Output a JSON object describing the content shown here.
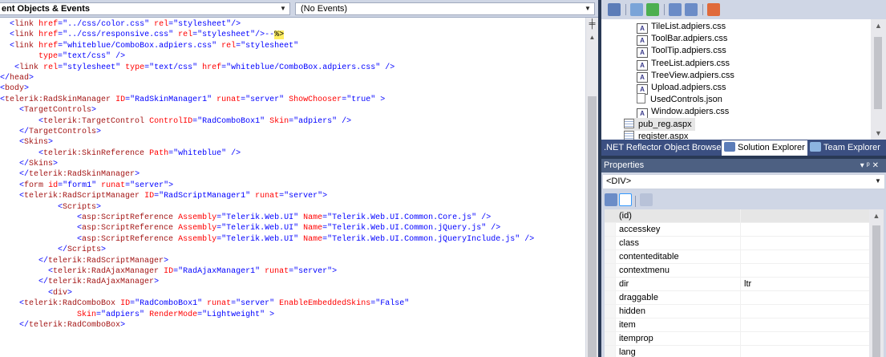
{
  "editor": {
    "nav_left": "ent Objects & Events",
    "nav_right": "(No Events)"
  },
  "code_lines": [
    [
      [
        "tx",
        "  "
      ],
      [
        "tb",
        "<"
      ],
      [
        "tk",
        "link"
      ],
      [
        "tx",
        " "
      ],
      [
        "tr",
        "href"
      ],
      [
        "tb",
        "=\"../css/color.css\""
      ],
      [
        "tx",
        " "
      ],
      [
        "tr",
        "rel"
      ],
      [
        "tb",
        "=\"stylesheet\"/>"
      ]
    ],
    [
      [
        "tx",
        "  "
      ],
      [
        "tb",
        "<"
      ],
      [
        "tk",
        "link"
      ],
      [
        "tx",
        " "
      ],
      [
        "tr",
        "href"
      ],
      [
        "tb",
        "=\"../css/responsive.css\""
      ],
      [
        "tx",
        " "
      ],
      [
        "tr",
        "rel"
      ],
      [
        "tb",
        "=\"stylesheet\"/>--"
      ],
      [
        "ty",
        "%>"
      ]
    ],
    [
      [
        "tx",
        "  "
      ],
      [
        "tb",
        "<"
      ],
      [
        "tk",
        "link"
      ],
      [
        "tx",
        " "
      ],
      [
        "tr",
        "href"
      ],
      [
        "tb",
        "=\"whiteblue/ComboBox.adpiers.css\""
      ],
      [
        "tx",
        " "
      ],
      [
        "tr",
        "rel"
      ],
      [
        "tb",
        "=\"stylesheet\""
      ]
    ],
    [
      [
        "tx",
        "        "
      ],
      [
        "tr",
        "type"
      ],
      [
        "tb",
        "=\"text/css\""
      ],
      [
        "tx",
        " "
      ],
      [
        "tb",
        "/>"
      ]
    ],
    [
      [
        "tx",
        "   "
      ],
      [
        "tb",
        "<"
      ],
      [
        "tk",
        "link"
      ],
      [
        "tx",
        " "
      ],
      [
        "tr",
        "rel"
      ],
      [
        "tb",
        "=\"stylesheet\""
      ],
      [
        "tx",
        " "
      ],
      [
        "tr",
        "type"
      ],
      [
        "tb",
        "=\"text/css\""
      ],
      [
        "tx",
        " "
      ],
      [
        "tr",
        "href"
      ],
      [
        "tb",
        "=\"whiteblue/ComboBox.adpiers.css\""
      ],
      [
        "tx",
        " "
      ],
      [
        "tb",
        "/>"
      ]
    ],
    [
      [
        "tb",
        "</"
      ],
      [
        "tk",
        "head"
      ],
      [
        "tb",
        ">"
      ]
    ],
    [
      [
        "tb",
        "<"
      ],
      [
        "tk",
        "body"
      ],
      [
        "tb",
        ">"
      ]
    ],
    [
      [
        "tb",
        "<"
      ],
      [
        "tk",
        "telerik:RadSkinManager"
      ],
      [
        "tx",
        " "
      ],
      [
        "tr",
        "ID"
      ],
      [
        "tb",
        "=\"RadSkinManager1\""
      ],
      [
        "tx",
        " "
      ],
      [
        "tr",
        "runat"
      ],
      [
        "tb",
        "=\"server\""
      ],
      [
        "tx",
        " "
      ],
      [
        "tr",
        "ShowChooser"
      ],
      [
        "tb",
        "=\"true\""
      ],
      [
        "tx",
        " "
      ],
      [
        "tb",
        ">"
      ]
    ],
    [
      [
        "tx",
        "    "
      ],
      [
        "tb",
        "<"
      ],
      [
        "tk",
        "TargetControls"
      ],
      [
        "tb",
        ">"
      ]
    ],
    [
      [
        "tx",
        "        "
      ],
      [
        "tb",
        "<"
      ],
      [
        "tk",
        "telerik:TargetControl"
      ],
      [
        "tx",
        " "
      ],
      [
        "tr",
        "ControlID"
      ],
      [
        "tb",
        "=\"RadComboBox1\""
      ],
      [
        "tx",
        " "
      ],
      [
        "tr",
        "Skin"
      ],
      [
        "tb",
        "=\"adpiers\""
      ],
      [
        "tx",
        " "
      ],
      [
        "tb",
        "/>"
      ]
    ],
    [
      [
        "tx",
        "    "
      ],
      [
        "tb",
        "</"
      ],
      [
        "tk",
        "TargetControls"
      ],
      [
        "tb",
        ">"
      ]
    ],
    [
      [
        "tx",
        "    "
      ],
      [
        "tb",
        "<"
      ],
      [
        "tk",
        "Skins"
      ],
      [
        "tb",
        ">"
      ]
    ],
    [
      [
        "tx",
        "        "
      ],
      [
        "tb",
        "<"
      ],
      [
        "tk",
        "telerik:SkinReference"
      ],
      [
        "tx",
        " "
      ],
      [
        "tr",
        "Path"
      ],
      [
        "tb",
        "=\"whiteblue\""
      ],
      [
        "tx",
        " "
      ],
      [
        "tb",
        "/>"
      ]
    ],
    [
      [
        "tx",
        "    "
      ],
      [
        "tb",
        "</"
      ],
      [
        "tk",
        "Skins"
      ],
      [
        "tb",
        ">"
      ]
    ],
    [
      [
        "tx",
        "    "
      ],
      [
        "tb",
        "</"
      ],
      [
        "tk",
        "telerik:RadSkinManager"
      ],
      [
        "tb",
        ">"
      ]
    ],
    [
      [
        "tx",
        "    "
      ],
      [
        "tb",
        "<"
      ],
      [
        "tk",
        "form"
      ],
      [
        "tx",
        " "
      ],
      [
        "tr",
        "id"
      ],
      [
        "tb",
        "=\"form1\""
      ],
      [
        "tx",
        " "
      ],
      [
        "tr",
        "runat"
      ],
      [
        "tb",
        "=\"server\""
      ],
      [
        "tb",
        ">"
      ]
    ],
    [
      [
        "tx",
        "    "
      ],
      [
        "tb",
        "<"
      ],
      [
        "tk",
        "telerik:RadScriptManager"
      ],
      [
        "tx",
        " "
      ],
      [
        "tr",
        "ID"
      ],
      [
        "tb",
        "=\"RadScriptManager1\""
      ],
      [
        "tx",
        " "
      ],
      [
        "tr",
        "runat"
      ],
      [
        "tb",
        "=\"server\""
      ],
      [
        "tb",
        ">"
      ]
    ],
    [
      [
        "tx",
        "            "
      ],
      [
        "tb",
        "<"
      ],
      [
        "tk",
        "Scripts"
      ],
      [
        "tb",
        ">"
      ]
    ],
    [
      [
        "tx",
        "                "
      ],
      [
        "tb",
        "<"
      ],
      [
        "tk",
        "asp:ScriptReference"
      ],
      [
        "tx",
        " "
      ],
      [
        "tr",
        "Assembly"
      ],
      [
        "tb",
        "=\"Telerik.Web.UI\""
      ],
      [
        "tx",
        " "
      ],
      [
        "tr",
        "Name"
      ],
      [
        "tb",
        "=\"Telerik.Web.UI.Common.Core.js\""
      ],
      [
        "tx",
        " "
      ],
      [
        "tb",
        "/>"
      ]
    ],
    [
      [
        "tx",
        "                "
      ],
      [
        "tb",
        "<"
      ],
      [
        "tk",
        "asp:ScriptReference"
      ],
      [
        "tx",
        " "
      ],
      [
        "tr",
        "Assembly"
      ],
      [
        "tb",
        "=\"Telerik.Web.UI\""
      ],
      [
        "tx",
        " "
      ],
      [
        "tr",
        "Name"
      ],
      [
        "tb",
        "=\"Telerik.Web.UI.Common.jQuery.js\""
      ],
      [
        "tx",
        " "
      ],
      [
        "tb",
        "/>"
      ]
    ],
    [
      [
        "tx",
        "                "
      ],
      [
        "tb",
        "<"
      ],
      [
        "tk",
        "asp:ScriptReference"
      ],
      [
        "tx",
        " "
      ],
      [
        "tr",
        "Assembly"
      ],
      [
        "tb",
        "=\"Telerik.Web.UI\""
      ],
      [
        "tx",
        " "
      ],
      [
        "tr",
        "Name"
      ],
      [
        "tb",
        "=\"Telerik.Web.UI.Common.jQueryInclude.js\""
      ],
      [
        "tx",
        " "
      ],
      [
        "tb",
        "/>"
      ]
    ],
    [
      [
        "tx",
        "            "
      ],
      [
        "tb",
        "</"
      ],
      [
        "tk",
        "Scripts"
      ],
      [
        "tb",
        ">"
      ]
    ],
    [
      [
        "tx",
        "        "
      ],
      [
        "tb",
        "</"
      ],
      [
        "tk",
        "telerik:RadScriptManager"
      ],
      [
        "tb",
        ">"
      ]
    ],
    [
      [
        "tx",
        "          "
      ],
      [
        "tb",
        "<"
      ],
      [
        "tk",
        "telerik:RadAjaxManager"
      ],
      [
        "tx",
        " "
      ],
      [
        "tr",
        "ID"
      ],
      [
        "tb",
        "=\"RadAjaxManager1\""
      ],
      [
        "tx",
        " "
      ],
      [
        "tr",
        "runat"
      ],
      [
        "tb",
        "=\"server\""
      ],
      [
        "tb",
        ">"
      ]
    ],
    [
      [
        "tx",
        "        "
      ],
      [
        "tb",
        "</"
      ],
      [
        "tk",
        "telerik:RadAjaxManager"
      ],
      [
        "tb",
        ">"
      ]
    ],
    [
      [
        "tx",
        "          "
      ],
      [
        "tb",
        "<"
      ],
      [
        "tk",
        "div"
      ],
      [
        "tb",
        ">"
      ]
    ],
    [
      [
        "tx",
        "    "
      ],
      [
        "tb",
        "<"
      ],
      [
        "tk",
        "telerik:RadComboBox"
      ],
      [
        "tx",
        " "
      ],
      [
        "tr",
        "ID"
      ],
      [
        "tb",
        "=\"RadComboBox1\""
      ],
      [
        "tx",
        " "
      ],
      [
        "tr",
        "runat"
      ],
      [
        "tb",
        "=\"server\""
      ],
      [
        "tx",
        " "
      ],
      [
        "tr",
        "EnableEmbeddedSkins"
      ],
      [
        "tb",
        "=\"False\""
      ]
    ],
    [
      [
        "tx",
        "                "
      ],
      [
        "tr",
        "Skin"
      ],
      [
        "tb",
        "=\"adpiers\""
      ],
      [
        "tx",
        " "
      ],
      [
        "tr",
        "RenderMode"
      ],
      [
        "tb",
        "=\"Lightweight\""
      ],
      [
        "tx",
        " "
      ],
      [
        "tb",
        ">"
      ]
    ],
    [
      [
        "tx",
        "    "
      ],
      [
        "tb",
        "</"
      ],
      [
        "tk",
        "telerik:RadComboBox"
      ],
      [
        "tb",
        ">"
      ]
    ]
  ],
  "solution_explorer": {
    "items": [
      {
        "label": "TileList.adpiers.css",
        "icon": "css"
      },
      {
        "label": "ToolBar.adpiers.css",
        "icon": "css"
      },
      {
        "label": "ToolTip.adpiers.css",
        "icon": "css"
      },
      {
        "label": "TreeList.adpiers.css",
        "icon": "css"
      },
      {
        "label": "TreeView.adpiers.css",
        "icon": "css"
      },
      {
        "label": "Upload.adpiers.css",
        "icon": "css"
      },
      {
        "label": "UsedControls.json",
        "icon": "file"
      },
      {
        "label": "Window.adpiers.css",
        "icon": "css"
      },
      {
        "label": "pub_reg.aspx",
        "icon": "aspx",
        "selected": true
      },
      {
        "label": "register.aspx",
        "icon": "aspx"
      }
    ]
  },
  "tabs": {
    "reflector": ".NET Reflector Object Browser",
    "solution_explorer": "Solution Explorer",
    "team_explorer": "Team Explorer"
  },
  "properties": {
    "title": "Properties",
    "object": "<DIV>",
    "rows": [
      {
        "name": "(id)",
        "value": "",
        "selected": true
      },
      {
        "name": "accesskey",
        "value": ""
      },
      {
        "name": "class",
        "value": ""
      },
      {
        "name": "contenteditable",
        "value": ""
      },
      {
        "name": "contextmenu",
        "value": ""
      },
      {
        "name": "dir",
        "value": "ltr"
      },
      {
        "name": "draggable",
        "value": ""
      },
      {
        "name": "hidden",
        "value": ""
      },
      {
        "name": "item",
        "value": ""
      },
      {
        "name": "itemprop",
        "value": ""
      },
      {
        "name": "lang",
        "value": ""
      },
      {
        "name": "",
        "value": ""
      }
    ]
  },
  "icons": {
    "split": "split-icon",
    "pin": "pin-icon",
    "close": "close-icon"
  }
}
